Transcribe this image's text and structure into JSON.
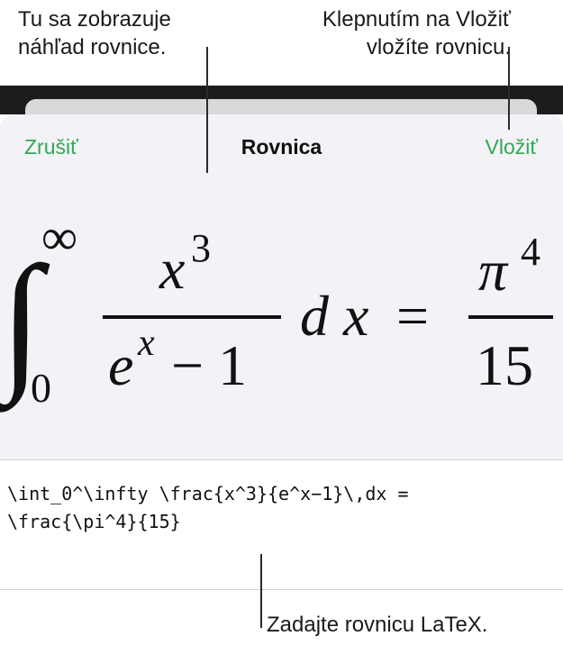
{
  "callouts": {
    "preview_line1": "Tu sa zobrazuje",
    "preview_line2": "náhľad rovnice.",
    "insert_line1": "Klepnutím na Vložiť",
    "insert_line2": "vložíte rovnicu.",
    "latex": "Zadajte rovnicu LaTeX."
  },
  "sheet": {
    "cancel_label": "Zrušiť",
    "title": "Rovnica",
    "insert_label": "Vložiť"
  },
  "equation": {
    "integral_lower": "0",
    "integral_upper": "∞",
    "numerator_base": "x",
    "numerator_exp": "3",
    "denominator_base": "e",
    "denominator_exp": "x",
    "denominator_tail": "− 1",
    "differential": "d x",
    "equals": "=",
    "rhs_numerator_base": "π",
    "rhs_numerator_exp": "4",
    "rhs_denominator": "15"
  },
  "latex_input": {
    "line1": "\\int_0^\\infty \\frac{x^3}{e^x−1}\\,dx =",
    "line2": "\\frac{\\pi^4}{15}"
  },
  "colors": {
    "accent": "#34a853",
    "sheet_background": "#f2f2f7",
    "dark_band": "#1c1c1e"
  }
}
